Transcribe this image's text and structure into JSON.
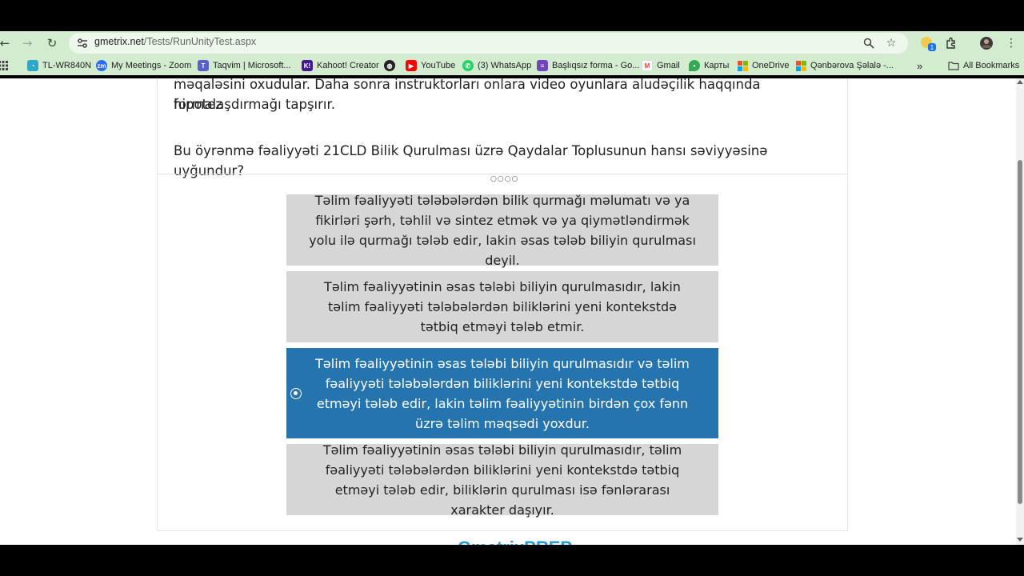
{
  "browser": {
    "url_domain": "gmetrix.net",
    "url_path": "/Tests/RunUnityTest.aspx",
    "extension_badge": "1"
  },
  "bookmarks": [
    {
      "label": "TL-WR840N",
      "icon": "tplink-icon",
      "color": "#2fa7c9"
    },
    {
      "label": "My Meetings - Zoom",
      "icon": "zoom-icon",
      "color": "#2d6df6"
    },
    {
      "label": "Taqvim | Microsoft...",
      "icon": "teams-icon",
      "color": "#5b5fc7"
    },
    {
      "label": "Kahoot! Creator",
      "icon": "kahoot-icon",
      "color": "#46178f"
    },
    {
      "label": "",
      "icon": "globe-icon",
      "color": "#222222"
    },
    {
      "label": "YouTube",
      "icon": "youtube-icon",
      "color": "#ff0000"
    },
    {
      "label": "(3) WhatsApp",
      "icon": "whatsapp-icon",
      "color": "#25d366"
    },
    {
      "label": "Başlıqsız forma - Go...",
      "icon": "forms-icon",
      "color": "#7248b9"
    },
    {
      "label": "Gmail",
      "icon": "gmail-icon",
      "color": "#ea4335"
    },
    {
      "label": "Карты",
      "icon": "maps-icon",
      "color": "#34a853"
    },
    {
      "label": "OneDrive",
      "icon": "microsoft-icon",
      "color": "#f25022"
    },
    {
      "label": "Qənbərova Şəlalə -...",
      "icon": "microsoft-icon",
      "color": "#f25022"
    }
  ],
  "all_bookmarks_label": "All Bookmarks",
  "question": {
    "line1": "məqaləsini oxudular. Daha sonra instruktorları onlara video oyunlara aludəçilik haqqında hipotez",
    "line2": "formalaşdırmağı tapşırır.",
    "prompt": "Bu öyrənmə fəaliyyəti 21CLD Bilik Qurulması üzrə Qaydalar Toplusunun hansı səviyyəsinə uyğundur?"
  },
  "pager_dots": "○○○○",
  "options": [
    {
      "text": "Təlim fəaliyyəti tələbələrdən bilik qurmağı məlumatı və ya fikirləri şərh, təhlil və sintez etmək və ya qiymətləndirmək yolu ilə qurmağı tələb edir, lakin əsas tələb biliyin qurulması deyil.",
      "selected": false
    },
    {
      "text": "Təlim fəaliyyətinin əsas tələbi biliyin qurulmasıdır, lakin təlim fəaliyyəti tələbələrdən biliklərini yeni kontekstdə tətbiq etməyi tələb etmir.",
      "selected": false
    },
    {
      "text": "Təlim fəaliyyətinin əsas tələbi biliyin qurulmasıdır və təlim fəaliyyəti tələbələrdən biliklərini yeni kontekstdə tətbiq etməyi tələb edir, lakin təlim fəaliyyətinin birdən çox fənn üzrə təlim məqsədi yoxdur.",
      "selected": true
    },
    {
      "text": "Təlim fəaliyyətinin əsas tələbi biliyin qurulmasıdır, təlim fəaliyyəti tələbələrdən biliklərini yeni kontekstdə tətbiq etməyi tələb edir, biliklərin qurulması isə fənlərarası xarakter daşıyır.",
      "selected": false
    }
  ],
  "footer_logo": "GmetrixPREP",
  "colors": {
    "selected_option": "#2674ad",
    "option_bg": "#d6d6d6",
    "browser_chrome": "#d3ecd0"
  }
}
